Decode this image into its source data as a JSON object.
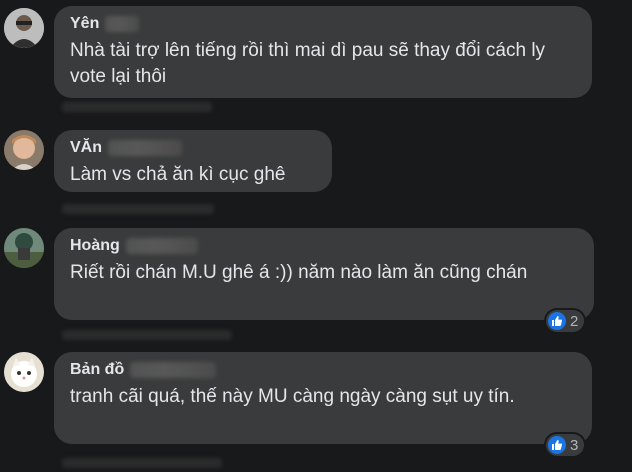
{
  "comments": [
    {
      "name": "Yên",
      "text": "Nhà tài trợ lên tiếng rồi thì mai dì pau sẽ thay đổi cách ly vote lại thôi",
      "reactions": null
    },
    {
      "name": "VĂn",
      "text": "Làm vs chả ăn kì cục ghê",
      "reactions": null
    },
    {
      "name": "Hoàng",
      "text": "Riết rồi chán M.U ghê á :)) năm nào làm ăn cũng chán",
      "reactions": "2"
    },
    {
      "name": "Bản đồ",
      "text": "tranh cãi quá, thế này MU càng ngày càng sụt uy tín.",
      "reactions": "3"
    }
  ],
  "icons": {
    "reaction": "like-icon"
  },
  "colors": {
    "background": "#18191a",
    "bubble": "#3a3b3c",
    "text": "#e4e6eb",
    "like": "#1b74e4"
  }
}
